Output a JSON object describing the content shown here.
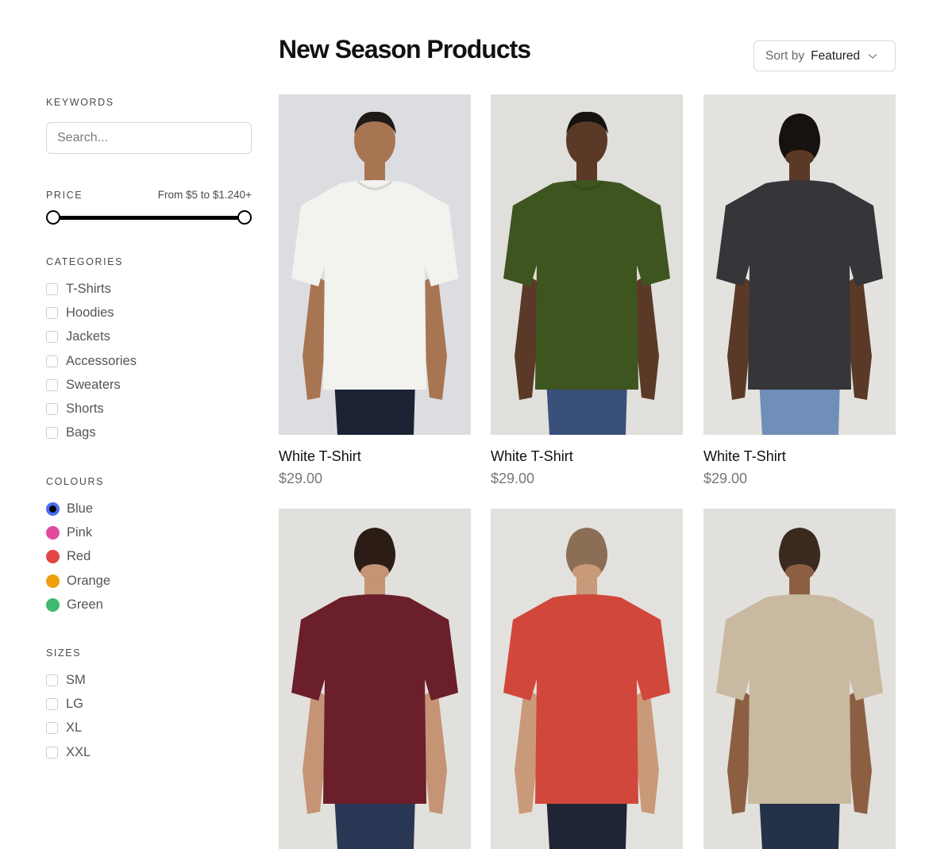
{
  "header": {
    "title": "New Season Products"
  },
  "sort": {
    "label": "Sort by",
    "value": "Featured"
  },
  "filters": {
    "keywords": {
      "title": "KEYWORDS",
      "placeholder": "Search..."
    },
    "price": {
      "title": "PRICE",
      "range_text": "From $5 to $1.240+"
    },
    "categories": {
      "title": "CATEGORIES",
      "items": [
        "T-Shirts",
        "Hoodies",
        "Jackets",
        "Accessories",
        "Sweaters",
        "Shorts",
        "Bags"
      ]
    },
    "colours": {
      "title": "COLOURS",
      "items": [
        {
          "label": "Blue",
          "color": "#4a6cf0",
          "selected": true
        },
        {
          "label": "Pink",
          "color": "#e24a9e",
          "selected": false
        },
        {
          "label": "Red",
          "color": "#e44545",
          "selected": false
        },
        {
          "label": "Orange",
          "color": "#f0a00c",
          "selected": false
        },
        {
          "label": "Green",
          "color": "#3fb972",
          "selected": false
        }
      ]
    },
    "sizes": {
      "title": "SIZES",
      "items": [
        "SM",
        "LG",
        "XL",
        "XXL"
      ]
    }
  },
  "products": [
    {
      "name": "White T-Shirt",
      "price": "$29.00",
      "shirt_color": "#f2f2ef",
      "bg_color": "#dcdde0",
      "skin": "#a87553",
      "hair": "#1f1a17",
      "pants": "#1c2233",
      "view": "front"
    },
    {
      "name": "White T-Shirt",
      "price": "$29.00",
      "shirt_color": "#3e5520",
      "bg_color": "#e0dfdc",
      "skin": "#5a3a26",
      "hair": "#151210",
      "pants": "#39507a",
      "view": "front"
    },
    {
      "name": "White T-Shirt",
      "price": "$29.00",
      "shirt_color": "#35353a",
      "bg_color": "#e3e2df",
      "skin": "#5a3a26",
      "hair": "#151210",
      "pants": "#6f8fb8",
      "view": "back"
    },
    {
      "name": "",
      "price": "",
      "shirt_color": "#6b1f2b",
      "bg_color": "#e2e0dc",
      "skin": "#c59474",
      "hair": "#2b1d15",
      "pants": "#2a3754",
      "view": "back"
    },
    {
      "name": "",
      "price": "",
      "shirt_color": "#d2473b",
      "bg_color": "#e3e1dd",
      "skin": "#c99a7a",
      "hair": "#8a6f56",
      "pants": "#1f2535",
      "view": "back"
    },
    {
      "name": "",
      "price": "",
      "shirt_color": "#c9b9a0",
      "bg_color": "#e2e0dc",
      "skin": "#8c5f43",
      "hair": "#3a2a20",
      "pants": "#253049",
      "view": "back"
    }
  ]
}
